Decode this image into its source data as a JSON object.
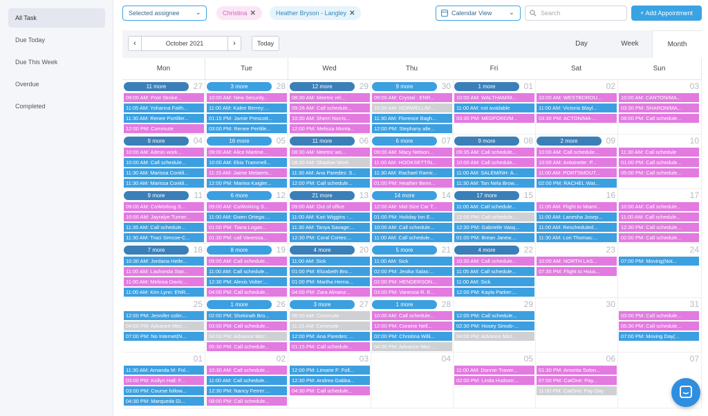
{
  "sidebar": {
    "items": [
      {
        "label": "All Task",
        "active": true
      },
      {
        "label": "Due Today"
      },
      {
        "label": "Due This Week"
      },
      {
        "label": "Overdue"
      },
      {
        "label": "Completed"
      }
    ]
  },
  "topbar": {
    "assignee_placeholder": "Selected assignee",
    "chips": [
      "Christina",
      "Heather Bryson - Langley"
    ],
    "view_select": "Calendar View",
    "search_placeholder": "Search",
    "add_button": "+ Add Appointment"
  },
  "calendar": {
    "month_label": "October 2021",
    "today_label": "Today",
    "views": [
      "Day",
      "Week",
      "Month"
    ],
    "active_view": "Month",
    "weekdays": [
      "Mon",
      "Tue",
      "Wed",
      "Thu",
      "Fri",
      "Sat",
      "Sun"
    ],
    "colors": {
      "pink": "#e27ae0",
      "blue": "#3c9fe0",
      "gray": "#cfd0d4",
      "pill_dark": "#3a7fb8",
      "pill_light": "#3c9fe0"
    },
    "weeks": [
      [
        {
          "day": "27",
          "more": "11 more",
          "events": [
            [
              "pink",
              "09:00 AM: Post Stroke..."
            ],
            [
              "blue",
              "11:05 AM: Yohanna Faith..."
            ],
            [
              "blue",
              "11:30 AM: Renee Portiller..."
            ],
            [
              "pink",
              "12:00 PM: Commute"
            ]
          ]
        },
        {
          "day": "28",
          "more": "3 more",
          "events": [
            [
              "pink",
              "10:00 AM: New Security..."
            ],
            [
              "blue",
              "11:00 AM: Kalee Berrey:..."
            ],
            [
              "blue",
              "01:15 PM: Jamie Prescott..."
            ],
            [
              "blue",
              "03:00 PM: Renee Pertille..."
            ]
          ]
        },
        {
          "day": "29",
          "more": "12 more",
          "events": [
            [
              "pink",
              "08:30 AM: Meetric rel..."
            ],
            [
              "pink",
              "09:26 AM: Call schedule..."
            ],
            [
              "pink",
              "10:30 AM: Sherri Norris..."
            ],
            [
              "pink",
              "12:00 PM: Melissa Monta..."
            ]
          ]
        },
        {
          "day": "30",
          "more": "9 more",
          "events": [
            [
              "pink",
              "09:00 AM: Crystal : ENR..."
            ],
            [
              "gray",
              "10:00 AM: NORWELL/M..."
            ],
            [
              "blue",
              "11:30 AM: Florence Bagh..."
            ],
            [
              "blue",
              "12:00 PM: Stephany alle..."
            ]
          ]
        },
        {
          "day": "01",
          "more": "1 more",
          "events": [
            [
              "pink",
              "10:00 AM: WALTHAM/M..."
            ],
            [
              "blue",
              "11:00 AM: not available"
            ],
            [
              "pink",
              "03:30 PM: MEDFORD/M..."
            ]
          ]
        },
        {
          "day": "02",
          "more": "",
          "events": [
            [
              "pink",
              "10:00 AM: WESTBOROU..."
            ],
            [
              "blue",
              "11:00 AM: Victoria Blayl..."
            ],
            [
              "pink",
              "03:30 PM: ACTON/MA-..."
            ]
          ]
        },
        {
          "day": "03",
          "more": "",
          "events": [
            [
              "pink",
              "10:00 AM: CANTON/MA..."
            ],
            [
              "pink",
              "03:30 PM: SHARON/MA..."
            ],
            [
              "pink",
              "08:00 PM: Call schedule..."
            ]
          ]
        }
      ],
      [
        {
          "day": "04",
          "more": "9 more",
          "events": [
            [
              "pink",
              "10:00 AM: Admin work..."
            ],
            [
              "blue",
              "10:00 AM: Call schedule..."
            ],
            [
              "blue",
              "11:30 AM: Marissa Conkli..."
            ],
            [
              "blue",
              "11:30 AM: Marissa Conkli..."
            ]
          ]
        },
        {
          "day": "05",
          "more": "16 more",
          "events": [
            [
              "pink",
              "09:00 AM: Alice Martine..."
            ],
            [
              "blue",
              "10:00 AM: Ekia Trammell..."
            ],
            [
              "pink",
              "11:15 AM: Jaime Melaerts..."
            ],
            [
              "blue",
              "12:00 PM: Mariea Kaigler..."
            ]
          ]
        },
        {
          "day": "06",
          "more": "11 more",
          "events": [
            [
              "pink",
              "08:30 AM: Meetric wo..."
            ],
            [
              "gray",
              "08:30 AM: Shadow Work"
            ],
            [
              "blue",
              "11:30 AM: Ana Paredes: S..."
            ],
            [
              "blue",
              "12:00 PM: Call schedule..."
            ]
          ]
        },
        {
          "day": "07",
          "more": "6 more",
          "events": [
            [
              "pink",
              "09:00 AM: Macy Nelson..."
            ],
            [
              "pink",
              "11:00 AM: HOOKSETT/N..."
            ],
            [
              "blue",
              "11:30 AM: Rachael Ramir..."
            ],
            [
              "pink",
              "01:00 PM: Heather Benn..."
            ]
          ]
        },
        {
          "day": "08",
          "more": "9 more",
          "events": [
            [
              "pink",
              "09:35 AM: Call schedule..."
            ],
            [
              "pink",
              "10:00 AM: Call schedule..."
            ],
            [
              "blue",
              "11:00 AM: SALEM/NH- A..."
            ],
            [
              "blue",
              "11:30 AM: Tan Nela Brow..."
            ]
          ]
        },
        {
          "day": "09",
          "more": "2 more",
          "events": [
            [
              "pink",
              "10:00 AM: Call schedule..."
            ],
            [
              "pink",
              "10:00 AM: Antoinette: P..."
            ],
            [
              "pink",
              "11:00 AM: PORTSMOUT..."
            ],
            [
              "blue",
              "02:00 PM: RACHEL Wat..."
            ]
          ]
        },
        {
          "day": "10",
          "more": "",
          "events": [
            [
              "pink",
              "11:30 AM: Call schedule"
            ],
            [
              "pink",
              "01:00 PM: Call schedule..."
            ],
            [
              "pink",
              "05:00 PM: Call schedule..."
            ]
          ]
        }
      ],
      [
        {
          "day": "11",
          "more": "9 more",
          "events": [
            [
              "pink",
              "09:00 AM: CoWorking S..."
            ],
            [
              "pink",
              "10:00 AM: Jayralye Turner..."
            ],
            [
              "blue",
              "11:35 AM: Call schedule..."
            ],
            [
              "blue",
              "11:30 AM: Traci Simcoe-C..."
            ]
          ]
        },
        {
          "day": "12",
          "more": "6 more",
          "events": [
            [
              "pink",
              "09:00 AM: CoWorking S..."
            ],
            [
              "blue",
              "11:00 AM: Gwen Ortega:..."
            ],
            [
              "pink",
              "01:00 PM: Tiana Logan..."
            ],
            [
              "pink",
              "01:30 PM: call Vanessa..."
            ]
          ]
        },
        {
          "day": "13",
          "more": "21 more",
          "events": [
            [
              "pink",
              "09:00 AM: Out of office"
            ],
            [
              "blue",
              "11:00 AM: Kari Wiggins -..."
            ],
            [
              "blue",
              "11:30 AM: Tanya Savage:..."
            ],
            [
              "blue",
              "12:30 PM: Coral Cortes:..."
            ]
          ]
        },
        {
          "day": "14",
          "more": "14 more",
          "events": [
            [
              "pink",
              "12:00 AM: Mid-Size Car T..."
            ],
            [
              "blue",
              "01:00 PM: Holiday Inn E..."
            ],
            [
              "blue",
              "10:00 AM: Call schedule..."
            ],
            [
              "blue",
              "11:00 AM: Call schedule..."
            ]
          ]
        },
        {
          "day": "15",
          "more": "17 more",
          "events": [
            [
              "blue",
              "11:00 AM: Call schedule..."
            ],
            [
              "gray",
              "12:00 PM: Call schedule..."
            ],
            [
              "blue",
              "12:30 PM: Gabrielle Vasq..."
            ],
            [
              "blue",
              "01:00 PM: Brean Janea:..."
            ]
          ]
        },
        {
          "day": "16",
          "more": "",
          "events": [
            [
              "pink",
              "11:05 AM: Flight to Miami..."
            ],
            [
              "blue",
              "11:00 AM: Lanesha Josep..."
            ],
            [
              "blue",
              "11:00 AM: Rescheduled..."
            ],
            [
              "blue",
              "11:30 AM: Lori Thomas:..."
            ]
          ]
        },
        {
          "day": "17",
          "more": "",
          "events": [
            [
              "pink",
              "10:00 AM: Call schedule..."
            ],
            [
              "pink",
              "11:00 AM: Call schedule..."
            ],
            [
              "pink",
              "12:30 PM: Call schedule..."
            ],
            [
              "pink",
              "02:00 PM: Call schedule..."
            ]
          ]
        }
      ],
      [
        {
          "day": "18",
          "more": "7 more",
          "events": [
            [
              "blue",
              "10:30 AM: Jordana Hetle..."
            ],
            [
              "pink",
              "11:00 AM: Lashonda Star..."
            ],
            [
              "pink",
              "11:00 AM: Melissa Davis:..."
            ],
            [
              "blue",
              "11:00 AM: Kim Lynn: ENR..."
            ]
          ]
        },
        {
          "day": "19",
          "more": "8 more",
          "events": [
            [
              "pink",
              "09:00 AM: Call schedule..."
            ],
            [
              "blue",
              "11:00 AM: Call schedule..."
            ],
            [
              "blue",
              "12:30 PM: Alexis Volter:..."
            ],
            [
              "pink",
              "04:00 PM: Call schedule..."
            ]
          ]
        },
        {
          "day": "20",
          "more": "4 more",
          "events": [
            [
              "blue",
              "11:00 AM: Sick"
            ],
            [
              "blue",
              "01:00 PM: Elizabeth Bro..."
            ],
            [
              "blue",
              "01:00 PM: Martha Herna..."
            ],
            [
              "pink",
              "04:00 PM: Zara Almanz..."
            ]
          ]
        },
        {
          "day": "21",
          "more": "5 more",
          "events": [
            [
              "blue",
              "11:00 AM: Sick"
            ],
            [
              "blue",
              "02:00 PM: Jesika Salas:..."
            ],
            [
              "pink",
              "02:00 PM: HENDERSON..."
            ],
            [
              "pink",
              "03:00 PM: Vanessa R. E..."
            ]
          ]
        },
        {
          "day": "22",
          "more": "4 more",
          "events": [
            [
              "pink",
              "10:30 AM: Call schedule..."
            ],
            [
              "blue",
              "11:05 AM: Call schedule..."
            ],
            [
              "blue",
              "11:00 AM: Sick"
            ],
            [
              "blue",
              "12:00 PM: Kayla Parker:..."
            ]
          ]
        },
        {
          "day": "23",
          "more": "",
          "events": [
            [
              "pink",
              "10:00 AM: NORTH LAS..."
            ],
            [
              "pink",
              "07:35 PM: Flight to Hous..."
            ]
          ]
        },
        {
          "day": "24",
          "more": "",
          "events": [
            [
              "blue",
              "07:00 PM: Moving(Not..."
            ]
          ]
        }
      ],
      [
        {
          "day": "25",
          "more": "",
          "events": [
            [
              "blue",
              "12:00 PM: Jennifer colin:..."
            ],
            [
              "gray",
              "04:00 PM: Advance Micr..."
            ],
            [
              "blue",
              "07:00 PM: No Internet(N..."
            ]
          ]
        },
        {
          "day": "26",
          "more": "1 more",
          "events": [
            [
              "blue",
              "02:00 PM: Shekinah Bro..."
            ],
            [
              "pink",
              "03:00 PM: Call schedule..."
            ],
            [
              "gray",
              "04:00 PM: Advance Micr..."
            ],
            [
              "pink",
              "05:30 PM: Call schedule..."
            ]
          ]
        },
        {
          "day": "27",
          "more": "3 more",
          "events": [
            [
              "gray",
              "06:00 AM: Commute"
            ],
            [
              "gray",
              "11:15 AM: Commute"
            ],
            [
              "blue",
              "12:00 PM: Ana Paredes: ..."
            ],
            [
              "pink",
              "01:15 PM: Call schedule..."
            ]
          ]
        },
        {
          "day": "28",
          "more": "1 more",
          "events": [
            [
              "pink",
              "10:00 AM: Call schedule..."
            ],
            [
              "pink",
              "12:00 PM: Coraine Nell..."
            ],
            [
              "blue",
              "02:00 PM: Christina Willi..."
            ],
            [
              "gray",
              "04:00 PM: Advance Micr..."
            ]
          ]
        },
        {
          "day": "29",
          "more": "",
          "events": [
            [
              "blue",
              "12:00 PM: Call schedule..."
            ],
            [
              "blue",
              "02:30 PM: Hosey Simob-..."
            ],
            [
              "gray",
              "04:00 PM: Advance Micr..."
            ]
          ]
        },
        {
          "day": "30",
          "more": "",
          "events": []
        },
        {
          "day": "31",
          "more": "",
          "events": [
            [
              "pink",
              "03:00 PM: Call schedule..."
            ],
            [
              "pink",
              "05:30 PM: Call schedule..."
            ],
            [
              "blue",
              "07:00 PM: Moving Day(..."
            ]
          ]
        }
      ],
      [
        {
          "day": "01",
          "more": "",
          "events": [
            [
              "blue",
              "11:30 AM: Amanda M: Fol..."
            ],
            [
              "pink",
              "03:00 PM: Kollyn Hall: F..."
            ],
            [
              "blue",
              "03:00 PM: Course follow..."
            ],
            [
              "blue",
              "04:30 PM: Marqueda Gi..."
            ]
          ]
        },
        {
          "day": "02",
          "more": "",
          "events": [
            [
              "pink",
              "10:30 AM: Call schedule..."
            ],
            [
              "blue",
              "11:00 AM: Call schedule..."
            ],
            [
              "blue",
              "12:30 PM: Nancy Ferrer:..."
            ],
            [
              "pink",
              "08:00 PM: Call schedule..."
            ]
          ]
        },
        {
          "day": "03",
          "more": "",
          "events": [
            [
              "blue",
              "12:00 PM: Limarie F: Foll..."
            ],
            [
              "blue",
              "12:30 PM: Andrea Gabba..."
            ],
            [
              "pink",
              "04:30 PM: Call schedule..."
            ]
          ]
        },
        {
          "day": "04",
          "more": "",
          "events": []
        },
        {
          "day": "05",
          "more": "",
          "events": [
            [
              "pink",
              "11:00 AM: Donnie Traver..."
            ],
            [
              "pink",
              "02:00 PM: Linda Hudson:..."
            ]
          ]
        },
        {
          "day": "06",
          "more": "",
          "events": [
            [
              "pink",
              "01:30 PM: Amorita Solon..."
            ],
            [
              "pink",
              "07:00 PM: CatOne: Pay..."
            ],
            [
              "gray",
              "11:00 PM: CatOne: Pay Day"
            ]
          ]
        },
        {
          "day": "07",
          "more": "",
          "events": []
        }
      ]
    ]
  }
}
